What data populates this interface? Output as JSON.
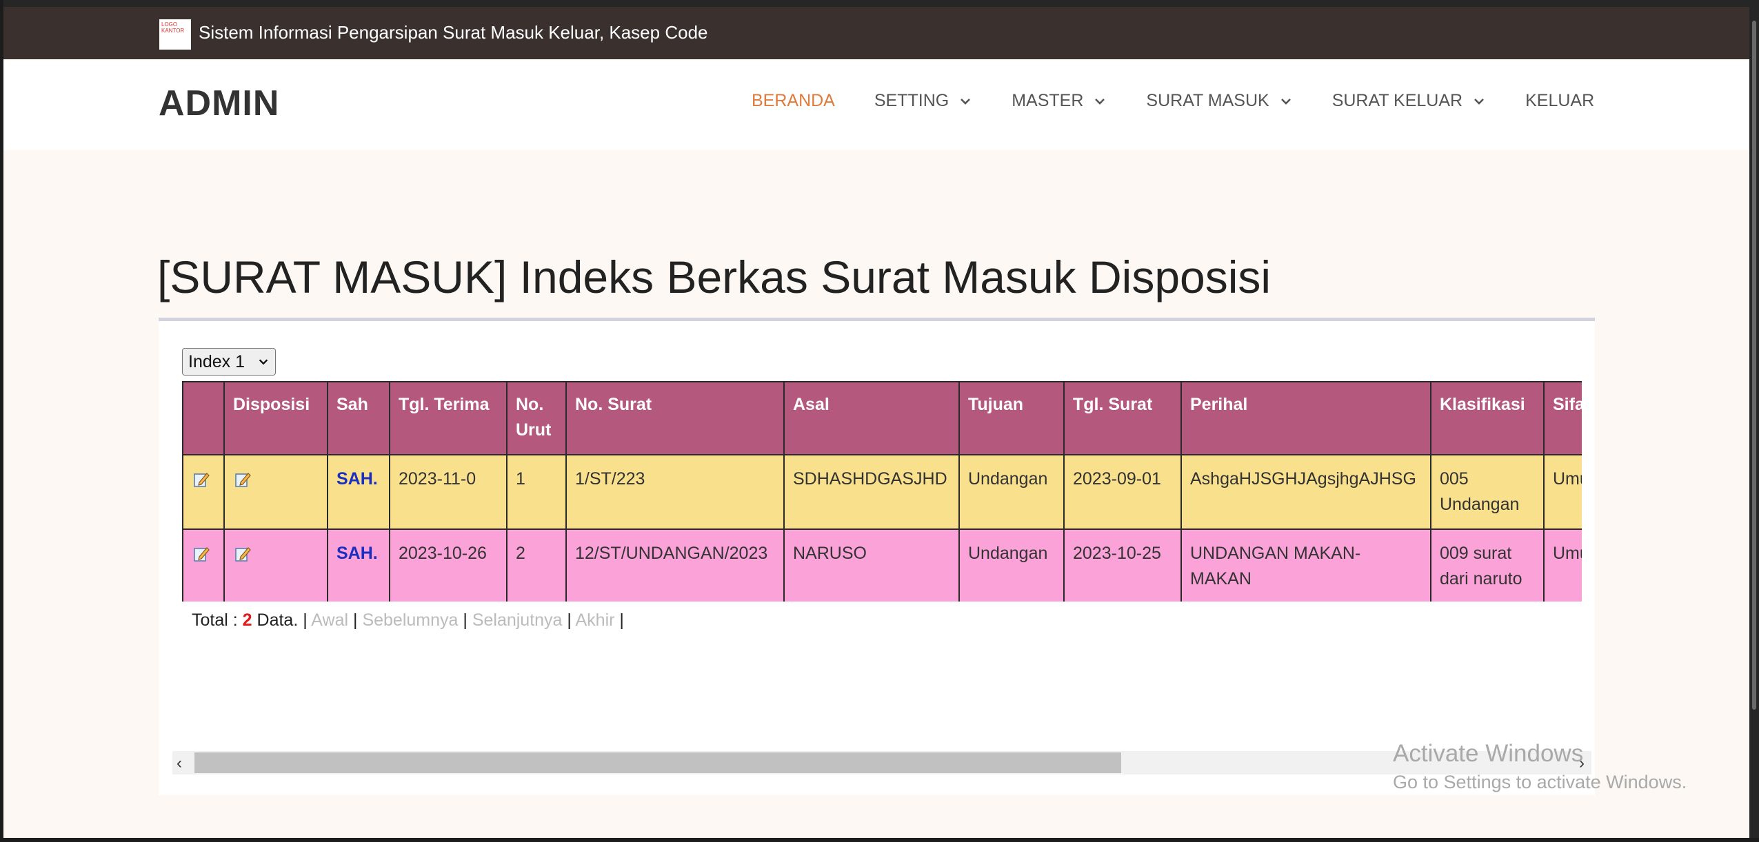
{
  "topbar": {
    "logo_text": "LOGO KANTOR",
    "site_title": "Sistem Informasi Pengarsipan Surat Masuk Keluar, Kasep Code"
  },
  "nav": {
    "brand": "ADMIN",
    "items": [
      {
        "label": "BERANDA",
        "dropdown": false,
        "active": true
      },
      {
        "label": "SETTING",
        "dropdown": true
      },
      {
        "label": "MASTER",
        "dropdown": true
      },
      {
        "label": "SURAT MASUK",
        "dropdown": true
      },
      {
        "label": "SURAT KELUAR",
        "dropdown": true
      },
      {
        "label": "KELUAR",
        "dropdown": false
      }
    ],
    "active_color": "#e07b3a"
  },
  "page": {
    "title": "[SURAT MASUK] Indeks Berkas Surat Masuk Disposisi"
  },
  "index_select": {
    "value": "Index 1"
  },
  "table": {
    "columns": [
      "",
      "Disposisi",
      "Sah",
      "Tgl. Terima",
      "No. Urut",
      "No. Surat",
      "Asal",
      "Tujuan",
      "Tgl. Surat",
      "Perihal",
      "Klasifikasi",
      "Sifat"
    ],
    "rows": [
      {
        "sah": "SAH.",
        "tgl_terima": "2023-11-0",
        "no_urut": "1",
        "no_surat": "1/ST/223",
        "asal": "SDHASHDGASJHD",
        "tujuan": "Undangan",
        "tgl_surat": "2023-09-01",
        "perihal": "AshgaHJSGHJAgsjhgAJHSG",
        "klasifikasi": "005 Undangan",
        "sifat": "Umum",
        "color": "#f8e08c"
      },
      {
        "sah": "SAH.",
        "tgl_terima": "2023-10-26",
        "no_urut": "2",
        "no_surat": "12/ST/UNDANGAN/2023",
        "asal": "NARUSO",
        "tujuan": "Undangan",
        "tgl_surat": "2023-10-25",
        "perihal": "UNDANGAN MAKAN-MAKAN",
        "klasifikasi": "009 surat dari naruto",
        "sifat": "Umum",
        "color": "#fba2d8"
      }
    ],
    "header_color": "#b5587e",
    "row_icon": "edit-document-icon"
  },
  "pager": {
    "total_label": "Total :",
    "total_count": "2",
    "data_label": "Data.",
    "first": "Awal",
    "prev": "Sebelumnya",
    "next": "Selanjutnya",
    "last": "Akhir"
  },
  "watermark": {
    "line1": "Activate Windows",
    "line2": "Go to Settings to activate Windows."
  }
}
